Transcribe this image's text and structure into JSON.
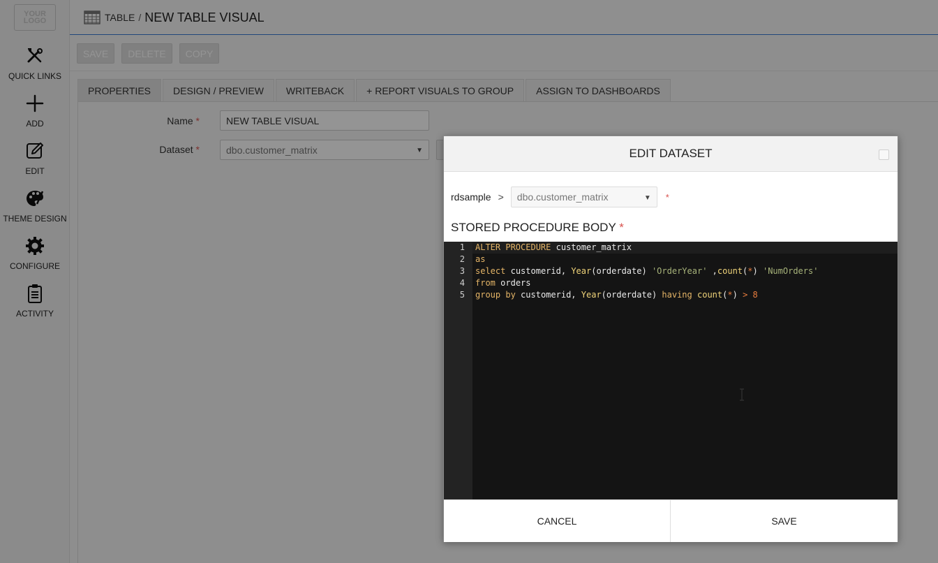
{
  "sidebar": {
    "logo_text": "YOUR LOGO",
    "items": [
      {
        "label": "QUICK LINKS",
        "icon": "tools-icon"
      },
      {
        "label": "ADD",
        "icon": "plus-icon"
      },
      {
        "label": "EDIT",
        "icon": "pencil-icon"
      },
      {
        "label": "THEME DESIGN",
        "icon": "palette-icon"
      },
      {
        "label": "CONFIGURE",
        "icon": "gear-icon"
      },
      {
        "label": "ACTIVITY",
        "icon": "clipboard-icon"
      }
    ]
  },
  "header": {
    "section": "TABLE",
    "separator": "/",
    "title": "NEW TABLE VISUAL"
  },
  "toolbar": {
    "save_label": "SAVE",
    "delete_label": "DELETE",
    "copy_label": "COPY"
  },
  "tabs": [
    {
      "label": "PROPERTIES",
      "active": true
    },
    {
      "label": "DESIGN / PREVIEW"
    },
    {
      "label": "WRITEBACK"
    },
    {
      "label": "+ REPORT VISUALS TO GROUP"
    },
    {
      "label": "ASSIGN TO DASHBOARDS"
    }
  ],
  "form": {
    "name_label": "Name",
    "name_value": "NEW TABLE VISUAL",
    "dataset_label": "Dataset",
    "dataset_value": "dbo.customer_matrix",
    "required_mark": "*"
  },
  "modal": {
    "title": "EDIT DATASET",
    "source": "rdsample",
    "arrow": ">",
    "procedure_select": "dbo.customer_matrix",
    "required_mark": "*",
    "section_title": "STORED PROCEDURE BODY",
    "code_lines": [
      "ALTER PROCEDURE customer_matrix",
      "as",
      "select customerid, Year(orderdate) 'OrderYear' ,count(*) 'NumOrders'",
      "from orders",
      "group by customerid, Year(orderdate) having count(*) > 8"
    ],
    "line_numbers": [
      "1",
      "2",
      "3",
      "4",
      "5"
    ],
    "cancel_label": "CANCEL",
    "save_label": "SAVE"
  },
  "colors": {
    "accent": "#3a7bd5",
    "required": "#d9534f",
    "editor_bg": "#141414",
    "keyword": "#e5b567",
    "string": "#a7b37a"
  }
}
